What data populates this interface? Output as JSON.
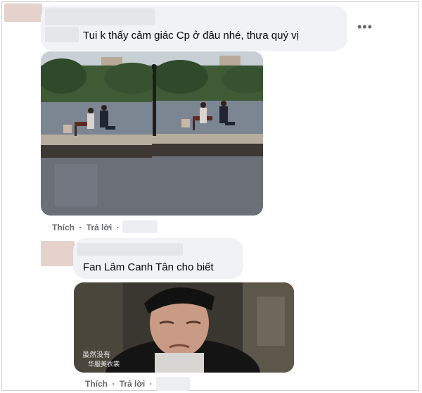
{
  "comment1": {
    "text": "Tui k thấy cảm giác Cp ở đâu nhé, thưa quý vị",
    "more_icon": "more-horizontal-icon",
    "photos": [
      {
        "description_icon": "photo"
      },
      {
        "description_icon": "photo"
      }
    ],
    "actions": {
      "like": "Thích",
      "reply": "Trả lời",
      "separator": "·"
    }
  },
  "comment2": {
    "text": "Fan Lâm Canh Tân cho biết",
    "media_subtitle_line1": "虽然没有",
    "media_subtitle_line2": "华服美衣裳",
    "actions": {
      "like": "Thích",
      "reply": "Trả lời",
      "separator": "·"
    }
  },
  "colors": {
    "bubble": "#f0f2f5",
    "text": "#050505",
    "secondary": "#65676b",
    "avatar_redacted": "#e6d2cc",
    "name_redacted": "#eceef1"
  }
}
